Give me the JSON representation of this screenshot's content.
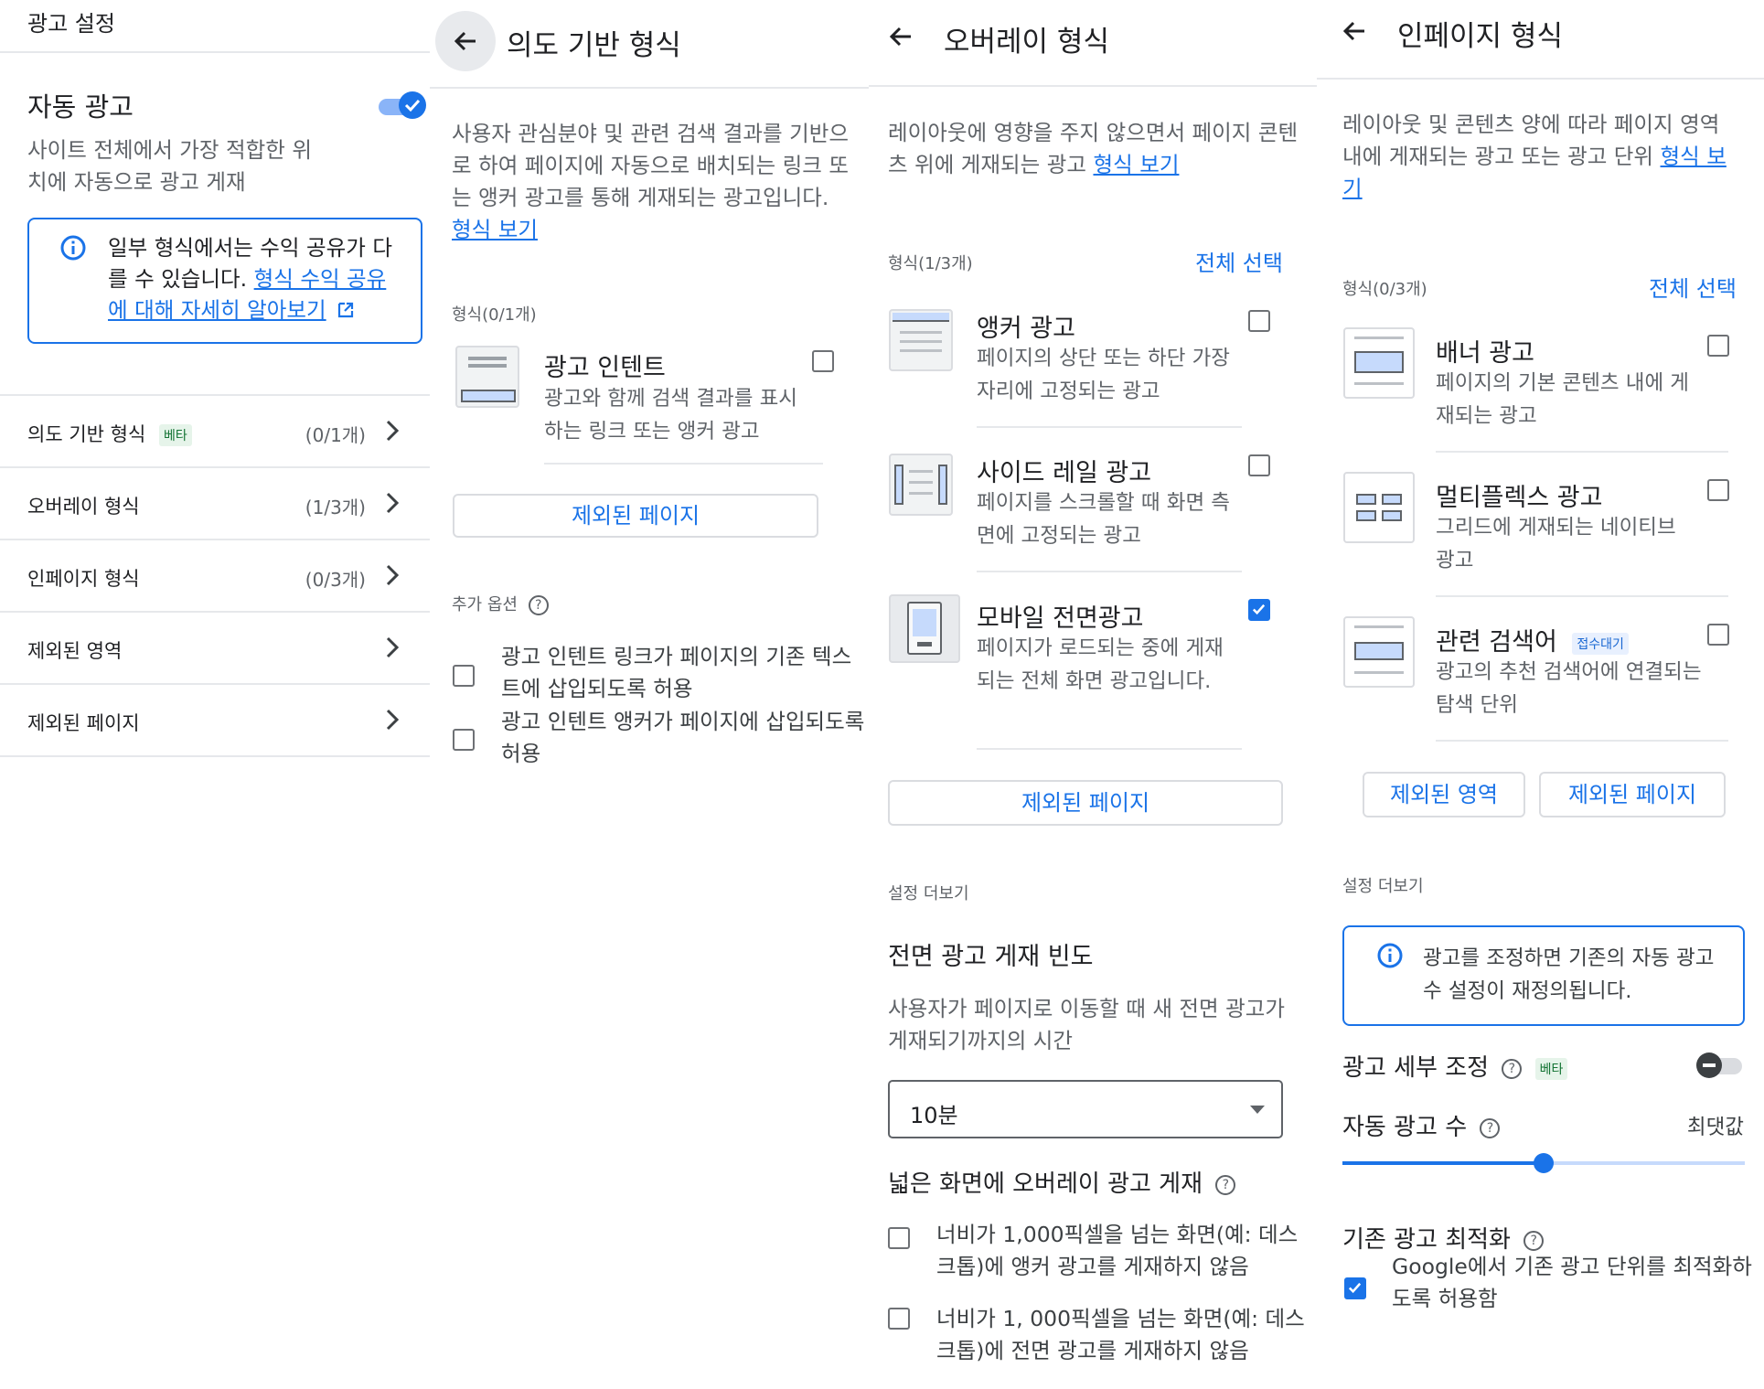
{
  "p1": {
    "header": "광고 설정",
    "auto_ads_title": "자동 광고",
    "auto_ads_desc": "사이트 전체에서 가장 적합한 위치에 자동으로 광고 게재",
    "auto_ads_toggle": "on",
    "info_text": "일부 형식에서는 수익 공유가 다를 수 있습니다.",
    "info_link": "형식 수익 공유에 대해 자세히 알아보기",
    "nav": [
      {
        "label": "의도 기반 형식",
        "badge": "베타",
        "count": "(0/1개)"
      },
      {
        "label": "오버레이 형식",
        "count": "(1/3개)"
      },
      {
        "label": "인페이지 형식",
        "count": "(0/3개)"
      },
      {
        "label": "제외된 영역"
      },
      {
        "label": "제외된 페이지"
      }
    ]
  },
  "p2": {
    "header": "의도 기반 형식",
    "desc": "사용자 관심분야 및 관련 검색 결과를 기반으로 하여 페이지에 자동으로 배치되는 링크 또는 앵커 광고를 통해 게재되는 광고입니다.",
    "desc_link": "형식 보기",
    "formats_label": "형식(0/1개)",
    "format": {
      "name": "광고 인텐트",
      "desc": "광고와 함께 검색 결과를 표시하는 링크 또는 앵커 광고",
      "checked": false
    },
    "excluded_pages_button": "제외된 페이지",
    "options_label": "추가 옵션",
    "options": [
      {
        "label": "광고 인텐트 링크가 페이지의 기존 텍스트에 삽입되도록 허용",
        "checked": false
      },
      {
        "label": "광고 인텐트 앵커가 페이지에 삽입되도록 허용",
        "checked": false
      }
    ]
  },
  "p3": {
    "header": "오버레이 형식",
    "desc": "레이아웃에 영향을 주지 않으면서 페이지 콘텐츠 위에 게재되는 광고",
    "desc_link": "형식 보기",
    "formats_label": "형식(1/3개)",
    "select_all": "전체 선택",
    "formats": [
      {
        "name": "앵커 광고",
        "desc": "페이지의 상단 또는 하단 가장자리에 고정되는 광고",
        "checked": false
      },
      {
        "name": "사이드 레일 광고",
        "desc": "페이지를 스크롤할 때 화면 측면에 고정되는 광고",
        "checked": false
      },
      {
        "name": "모바일 전면광고",
        "desc": "페이지가 로드되는 중에 게재되는 전체 화면 광고입니다.",
        "checked": true
      }
    ],
    "excluded_pages_button": "제외된 페이지",
    "more_settings": "설정 더보기",
    "frequency_title": "전면 광고 게재 빈도",
    "frequency_desc": "사용자가 페이지로 이동할 때 새 전면 광고가 게재되기까지의 시간",
    "frequency_value": "10분",
    "wide_title": "넓은 화면에 오버레이 광고 게재",
    "wide_options": [
      {
        "label": "너비가 1,000픽셀을 넘는 화면(예: 데스크톱)에 앵커 광고를 게재하지 않음",
        "checked": false
      },
      {
        "label": "너비가 1, 000픽셀을 넘는 화면(예: 데스크톱)에 전면 광고를 게재하지 않음",
        "checked": false
      }
    ]
  },
  "p4": {
    "header": "인페이지 형식",
    "desc": "레이아웃 및 콘텐츠 양에 따라 페이지 영역 내에 게재되는 광고 또는 광고 단위",
    "desc_link": "형식 보기",
    "formats_label": "형식(0/3개)",
    "select_all": "전체 선택",
    "formats": [
      {
        "name": "배너 광고",
        "desc": "페이지의 기본 콘텐츠 내에 게재되는 광고",
        "checked": false
      },
      {
        "name": "멀티플렉스 광고",
        "desc": "그리드에 게재되는 네이티브 광고",
        "checked": false
      },
      {
        "name": "관련 검색어",
        "badge": "접수대기",
        "desc": "광고의 추천 검색어에 연결되는 탐색 단위",
        "checked": false
      }
    ],
    "excluded_areas_button": "제외된 영역",
    "excluded_pages_button": "제외된 페이지",
    "more_settings": "설정 더보기",
    "info_text": "광고를 조정하면 기존의 자동 광고 수 설정이 재정의됩니다.",
    "fine_tune_label": "광고 세부 조정",
    "fine_tune_badge": "베타",
    "fine_tune_toggle": "off",
    "ad_count_label": "자동 광고 수",
    "ad_count_value_label": "최댓값",
    "ad_count_level": 0.5,
    "optimize_title": "기존 광고 최적화",
    "optimize_option": {
      "label": "Google에서 기존 광고 단위를 최적화하도록 허용함",
      "checked": true
    }
  },
  "colors": {
    "accent": "#1a73e8",
    "divider": "#e6e8eb",
    "beta_bg": "#e6f4ea",
    "beta_fg": "#137333"
  }
}
